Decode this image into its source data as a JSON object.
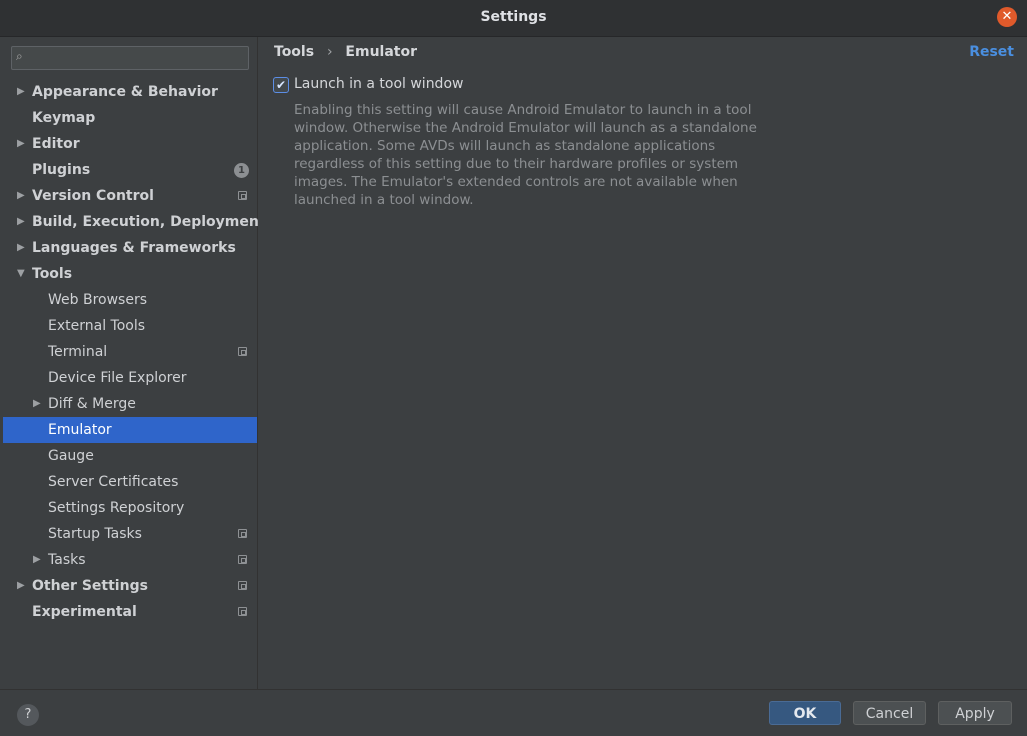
{
  "window": {
    "title": "Settings"
  },
  "search": {
    "placeholder": ""
  },
  "sidebar": {
    "items": [
      {
        "label": "Appearance & Behavior",
        "level": 0,
        "expandable": true,
        "expanded": false,
        "bold": true
      },
      {
        "label": "Keymap",
        "level": 0,
        "expandable": false,
        "bold": true
      },
      {
        "label": "Editor",
        "level": 0,
        "expandable": true,
        "expanded": false,
        "bold": true
      },
      {
        "label": "Plugins",
        "level": 0,
        "expandable": false,
        "bold": true,
        "badge": "1"
      },
      {
        "label": "Version Control",
        "level": 0,
        "expandable": true,
        "expanded": false,
        "bold": true,
        "project_icon": true
      },
      {
        "label": "Build, Execution, Deployment",
        "level": 0,
        "expandable": true,
        "expanded": false,
        "bold": true
      },
      {
        "label": "Languages & Frameworks",
        "level": 0,
        "expandable": true,
        "expanded": false,
        "bold": true
      },
      {
        "label": "Tools",
        "level": 0,
        "expandable": true,
        "expanded": true,
        "bold": true
      },
      {
        "label": "Web Browsers",
        "level": 1
      },
      {
        "label": "External Tools",
        "level": 1
      },
      {
        "label": "Terminal",
        "level": 1,
        "project_icon": true
      },
      {
        "label": "Device File Explorer",
        "level": 1
      },
      {
        "label": "Diff & Merge",
        "level": 1,
        "expandable": true,
        "expanded": false
      },
      {
        "label": "Emulator",
        "level": 1,
        "selected": true
      },
      {
        "label": "Gauge",
        "level": 1
      },
      {
        "label": "Server Certificates",
        "level": 1
      },
      {
        "label": "Settings Repository",
        "level": 1
      },
      {
        "label": "Startup Tasks",
        "level": 1,
        "project_icon": true
      },
      {
        "label": "Tasks",
        "level": 1,
        "expandable": true,
        "expanded": false,
        "project_icon": true
      },
      {
        "label": "Other Settings",
        "level": 0,
        "expandable": true,
        "expanded": false,
        "bold": true,
        "project_icon": true
      },
      {
        "label": "Experimental",
        "level": 0,
        "expandable": false,
        "bold": true,
        "project_icon": true
      }
    ]
  },
  "content": {
    "breadcrumb": [
      "Tools",
      "Emulator"
    ],
    "breadcrumb_separator": "›",
    "reset_label": "Reset",
    "option": {
      "label": "Launch in a tool window",
      "checked": true,
      "description": "Enabling this setting will cause Android Emulator to launch in a tool window. Otherwise the Android Emulator will launch as a standalone application. Some AVDs will launch as standalone applications regardless of this setting due to their hardware profiles or system images. The Emulator's extended controls are not available when launched in a tool window."
    }
  },
  "footer": {
    "help_label": "?",
    "ok_label": "OK",
    "cancel_label": "Cancel",
    "apply_label": "Apply"
  },
  "colors": {
    "accent": "#2f65ca",
    "link": "#4a8fe0",
    "close": "#e05a2b",
    "background": "#3c3f41"
  }
}
